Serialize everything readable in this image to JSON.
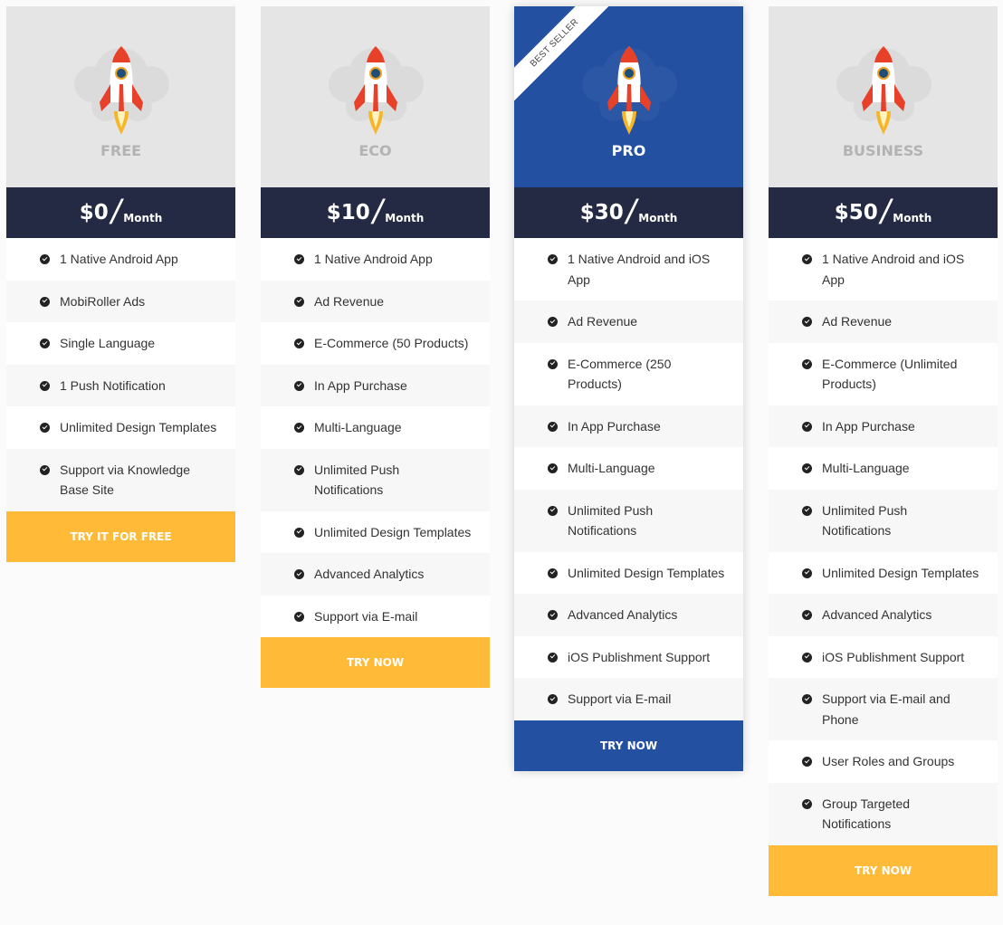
{
  "colors": {
    "header_gray": "#e5e5e5",
    "pro_blue": "#2350a0",
    "price_bar": "#252a44",
    "button_yellow": "#ffbb38"
  },
  "plans": [
    {
      "name": "FREE",
      "price": "$0",
      "period": "Month",
      "button": "TRY IT FOR FREE",
      "features": [
        "1 Native Android App",
        "MobiRoller Ads",
        "Single Language",
        "1 Push Notification",
        "Unlimited Design Templates",
        "Support via Knowledge Base Site"
      ]
    },
    {
      "name": "ECO",
      "price": "$10",
      "period": "Month",
      "button": "TRY NOW",
      "features": [
        "1 Native Android App",
        "Ad Revenue",
        "E-Commerce (50 Products)",
        "In App Purchase",
        "Multi-Language",
        "Unlimited Push Notifications",
        "Unlimited Design Templates",
        "Advanced Analytics",
        "Support via E-mail"
      ]
    },
    {
      "name": "PRO",
      "price": "$30",
      "period": "Month",
      "button": "TRY NOW",
      "ribbon": "BEST SELLER",
      "features": [
        "1 Native Android and iOS App",
        "Ad Revenue",
        "E-Commerce (250 Products)",
        "In App Purchase",
        "Multi-Language",
        "Unlimited Push Notifications",
        "Unlimited Design Templates",
        "Advanced Analytics",
        "iOS Publishment Support",
        "Support via E-mail"
      ]
    },
    {
      "name": "BUSINESS",
      "price": "$50",
      "period": "Month",
      "button": "TRY NOW",
      "features": [
        "1 Native Android and iOS App",
        "Ad Revenue",
        "E-Commerce (Unlimited Products)",
        "In App Purchase",
        "Multi-Language",
        "Unlimited Push Notifications",
        "Unlimited Design Templates",
        "Advanced Analytics",
        "iOS Publishment Support",
        "Support via E-mail and Phone",
        "User Roles and Groups",
        "Group Targeted Notifications"
      ]
    }
  ]
}
